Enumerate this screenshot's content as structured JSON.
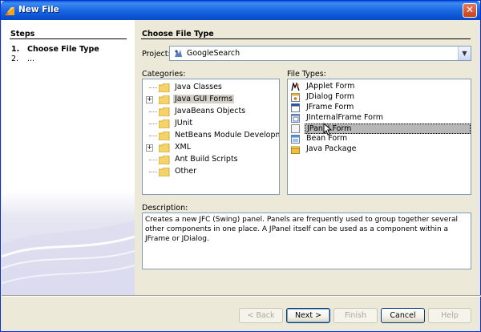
{
  "window": {
    "title": "New File",
    "close_glyph": "✕"
  },
  "steps": {
    "title": "Steps",
    "items": [
      {
        "num": "1.",
        "label": "Choose File Type"
      },
      {
        "num": "2.",
        "label": "..."
      }
    ]
  },
  "main": {
    "title": "Choose File Type",
    "project_label": "Project:",
    "project_value": "GoogleSearch",
    "project_icon": "project-icon",
    "categories_label": "Categories:",
    "categories": [
      {
        "label": "Java Classes",
        "expandable": false,
        "selected": false
      },
      {
        "label": "Java GUI Forms",
        "expandable": true,
        "selected": true
      },
      {
        "label": "JavaBeans Objects",
        "expandable": false,
        "selected": false
      },
      {
        "label": "JUnit",
        "expandable": false,
        "selected": false
      },
      {
        "label": "NetBeans Module Development",
        "expandable": false,
        "selected": false
      },
      {
        "label": "XML",
        "expandable": true,
        "selected": false
      },
      {
        "label": "Ant Build Scripts",
        "expandable": false,
        "selected": false
      },
      {
        "label": "Other",
        "expandable": false,
        "selected": false
      }
    ],
    "file_types_label": "File Types:",
    "file_types": [
      {
        "label": "JApplet Form",
        "icon": "applet-icon",
        "selected": false
      },
      {
        "label": "JDialog Form",
        "icon": "dialog-icon",
        "selected": false
      },
      {
        "label": "JFrame Form",
        "icon": "frame-icon",
        "selected": false
      },
      {
        "label": "JInternalFrame Form",
        "icon": "internal-frame-icon",
        "selected": false
      },
      {
        "label": "JPanel Form",
        "icon": "panel-icon",
        "selected": true
      },
      {
        "label": "Bean Form",
        "icon": "bean-icon",
        "selected": false
      },
      {
        "label": "Java Package",
        "icon": "package-icon",
        "selected": false
      }
    ],
    "description_label": "Description:",
    "description": "Creates a new JFC (Swing) panel. Panels are frequently used to group together several other components in one place. A JPanel itself can be used as a component within a JFrame or JDialog."
  },
  "buttons": {
    "back": "< Back",
    "next": "Next >",
    "finish": "Finish",
    "cancel": "Cancel",
    "help": "Help"
  },
  "colors": {
    "titlebar": "#0a55d3",
    "selection": "#d4d0c8",
    "dialog_bg": "#ece9d8"
  }
}
